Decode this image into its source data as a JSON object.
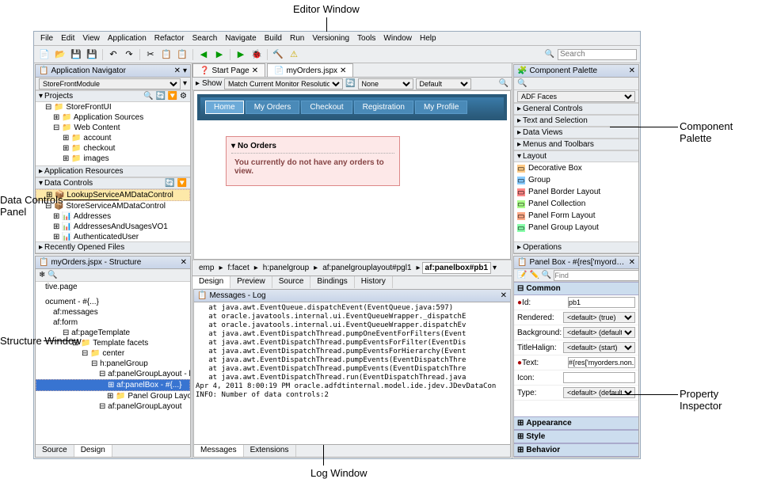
{
  "annotations": {
    "editor_window": "Editor Window",
    "component_palette": "Component Palette",
    "data_controls_panel": "Data Controls Panel",
    "structure_window": "Structure Window",
    "property_inspector": "Property Inspector",
    "log_window": "Log Window"
  },
  "menu": [
    "File",
    "Edit",
    "View",
    "Application",
    "Refactor",
    "Search",
    "Navigate",
    "Build",
    "Run",
    "Versioning",
    "Tools",
    "Window",
    "Help"
  ],
  "search_placeholder": "Search",
  "nav": {
    "title": "Application Navigator",
    "project_dropdown": "StoreFrontModule",
    "projects_label": "Projects",
    "tree": [
      "StoreFrontUI",
      "Application Sources",
      "Web Content",
      "account",
      "checkout",
      "images"
    ],
    "app_resources": "Application Resources",
    "data_controls_label": "Data Controls",
    "data_controls": [
      "LookupServiceAMDataControl",
      "StoreServiceAMDataControl",
      "Addresses",
      "AddressesAndUsagesVO1",
      "AuthenticatedUser"
    ],
    "recent": "Recently Opened Files"
  },
  "structure": {
    "title": "myOrders.jspx - Structure",
    "items": [
      "tive.page",
      "ocument - #{...}",
      "af:messages",
      "af:form",
      "af:pageTemplate",
      "Template facets",
      "center",
      "h:panelGroup",
      "af:panelGroupLayout - horizontal",
      "af:panelBox - #{...}",
      "Panel Group Layout facets",
      "af:panelGroupLayout"
    ],
    "tabs": [
      "Source",
      "Design"
    ]
  },
  "editor": {
    "tabs": [
      "Start Page",
      "myOrders.jspx"
    ],
    "show_label": "Show",
    "show_dropdown": "Match Current Monitor Resolution",
    "none_dropdown": "None",
    "default_dropdown": "Default",
    "page_tabs": [
      "Home",
      "My Orders",
      "Checkout",
      "Registration",
      "My Profile"
    ],
    "no_orders_title": "No Orders",
    "no_orders_msg": "You currently do not have any orders to view.",
    "breadcrumb": [
      "emp",
      "f:facet",
      "h:panelgroup",
      "af:panelgrouplayout#pgl1",
      "af:panelbox#pb1"
    ],
    "view_tabs": [
      "Design",
      "Preview",
      "Source",
      "Bindings",
      "History"
    ]
  },
  "log": {
    "title": "Messages - Log",
    "lines": [
      "   at java.awt.EventQueue.dispatchEvent(EventQueue.java:597)",
      "   at oracle.javatools.internal.ui.EventQueueWrapper._dispatchE",
      "   at oracle.javatools.internal.ui.EventQueueWrapper.dispatchEv",
      "   at java.awt.EventDispatchThread.pumpOneEventForFilters(Event",
      "   at java.awt.EventDispatchThread.pumpEventsForFilter(EventDis",
      "   at java.awt.EventDispatchThread.pumpEventsForHierarchy(Event",
      "   at java.awt.EventDispatchThread.pumpEvents(EventDispatchThre",
      "   at java.awt.EventDispatchThread.pumpEvents(EventDispatchThre",
      "   at java.awt.EventDispatchThread.run(EventDispatchThread.java",
      "Apr 4, 2011 8:00:19 PM oracle.adfdtinternal.model.ide.jdev.JDevDataCon",
      "INFO: Number of data controls:2"
    ],
    "tabs": [
      "Messages",
      "Extensions"
    ]
  },
  "palette": {
    "title": "Component Palette",
    "dropdown": "ADF Faces",
    "categories": [
      "General Controls",
      "Text and Selection",
      "Data Views",
      "Menus and Toolbars",
      "Layout"
    ],
    "items": [
      "Decorative Box",
      "Group",
      "Panel Border Layout",
      "Panel Collection",
      "Panel Form Layout",
      "Panel Group Layout"
    ],
    "operations": "Operations"
  },
  "inspector": {
    "title": "Panel Box - #{res['myorders.non...",
    "find": "Find",
    "common": "Common",
    "appearance": "Appearance",
    "style": "Style",
    "behavior": "Behavior",
    "props": {
      "id_label": "Id:",
      "id_val": "pb1",
      "rendered_label": "Rendered:",
      "rendered_val": "<default> (true)",
      "background_label": "Background:",
      "background_val": "<default> (default)",
      "titlehalign_label": "TitleHalign:",
      "titlehalign_val": "<default> (start)",
      "text_label": "Text:",
      "text_val": "#{res['myorders.non...",
      "icon_label": "Icon:",
      "icon_val": "",
      "type_label": "Type:",
      "type_val": "<default> (default)"
    }
  }
}
